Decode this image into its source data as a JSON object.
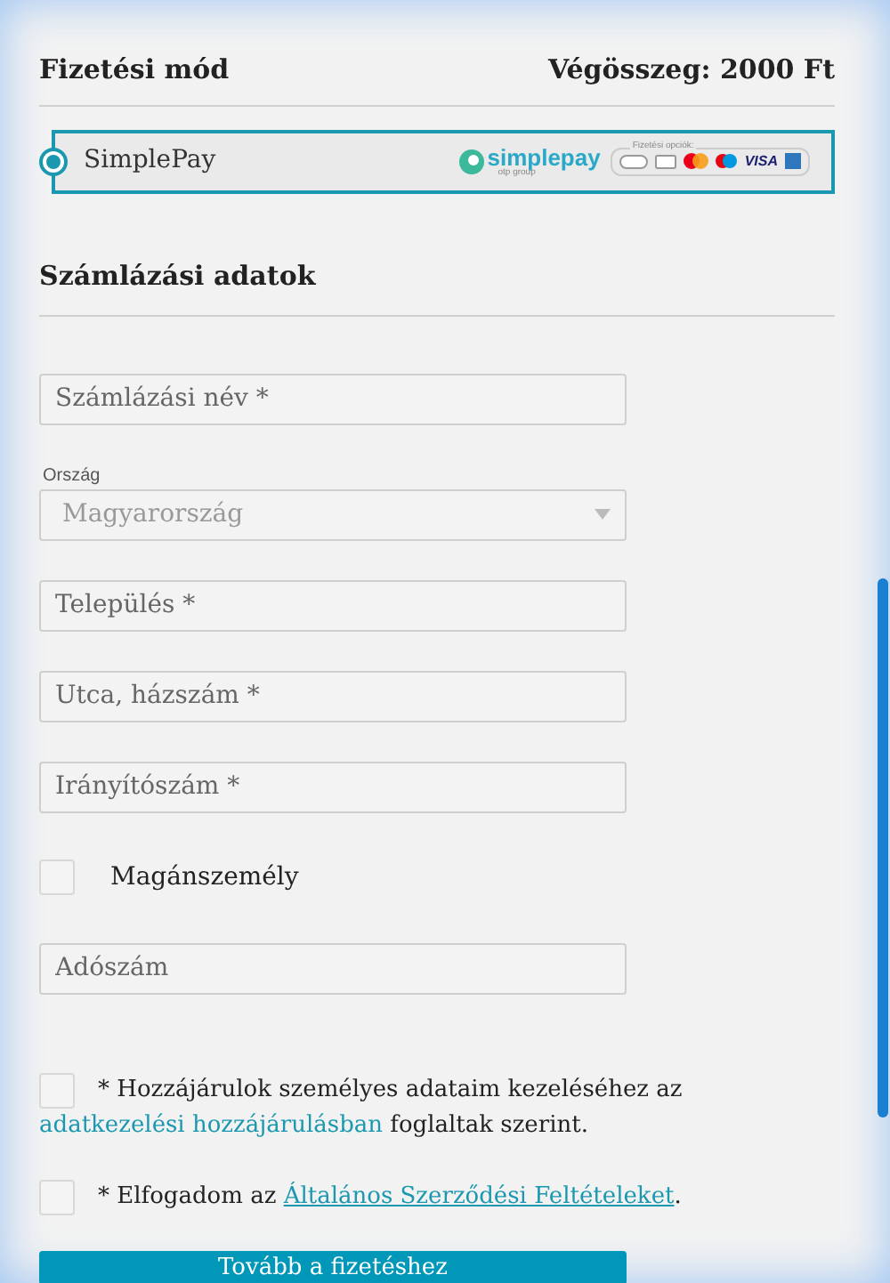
{
  "payment": {
    "title": "Fizetési mód",
    "total": "Végösszeg: 2000 Ft",
    "methods": [
      {
        "label": "SimplePay",
        "selected": true,
        "logo_text": "simplepay",
        "logo_subtext": "otp group",
        "options_label": "Fizetési opciók:",
        "card_text": "VISA"
      }
    ]
  },
  "billing": {
    "title": "Számlázási adatok",
    "fields": [
      {
        "kind": "input",
        "placeholder": "Számlázási név *"
      },
      {
        "kind": "select",
        "label": "Ország",
        "value": "Magyarország"
      },
      {
        "kind": "input",
        "placeholder": "Település *"
      },
      {
        "kind": "input",
        "placeholder": "Utca, házszám *"
      },
      {
        "kind": "input",
        "placeholder": "Irányítószám *"
      },
      {
        "kind": "checkbox",
        "label": "Magánszemély",
        "checked": false
      },
      {
        "kind": "input",
        "placeholder": "Adószám"
      }
    ]
  },
  "consents": [
    {
      "checked": false,
      "before": "* Hozzájárulok személyes adataim kezeléséhez az",
      "link": "adatkezelési hozzájárulásban",
      "link_underlined": false,
      "after": "foglaltak szerint."
    },
    {
      "checked": false,
      "before": "* Elfogadom az",
      "link": "Általános Szerződési Feltételeket",
      "link_underlined": true,
      "after": "."
    }
  ],
  "submit": "Tovább a fizetéshez"
}
